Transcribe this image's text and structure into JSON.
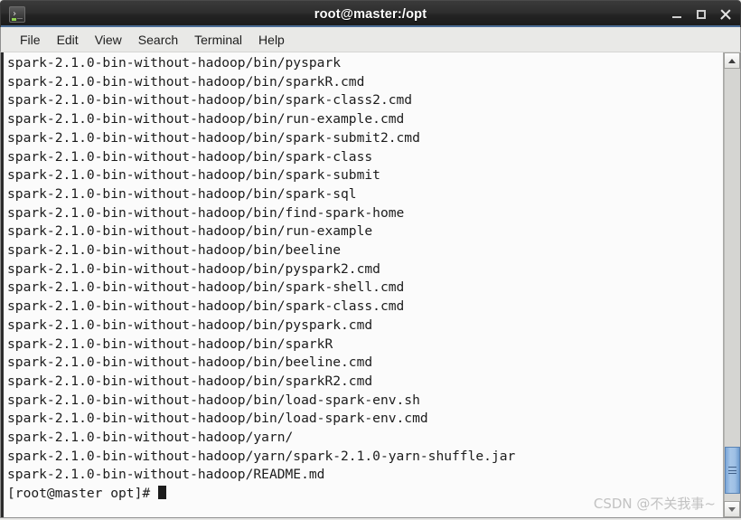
{
  "window": {
    "title": "root@master:/opt",
    "icon": "terminal-icon",
    "controls": {
      "minimize": "minimize-button",
      "maximize": "maximize-button",
      "close": "close-button"
    }
  },
  "menubar": {
    "items": [
      {
        "label": "File"
      },
      {
        "label": "Edit"
      },
      {
        "label": "View"
      },
      {
        "label": "Search"
      },
      {
        "label": "Terminal"
      },
      {
        "label": "Help"
      }
    ]
  },
  "terminal": {
    "lines": [
      "spark-2.1.0-bin-without-hadoop/bin/pyspark",
      "spark-2.1.0-bin-without-hadoop/bin/sparkR.cmd",
      "spark-2.1.0-bin-without-hadoop/bin/spark-class2.cmd",
      "spark-2.1.0-bin-without-hadoop/bin/run-example.cmd",
      "spark-2.1.0-bin-without-hadoop/bin/spark-submit2.cmd",
      "spark-2.1.0-bin-without-hadoop/bin/spark-class",
      "spark-2.1.0-bin-without-hadoop/bin/spark-submit",
      "spark-2.1.0-bin-without-hadoop/bin/spark-sql",
      "spark-2.1.0-bin-without-hadoop/bin/find-spark-home",
      "spark-2.1.0-bin-without-hadoop/bin/run-example",
      "spark-2.1.0-bin-without-hadoop/bin/beeline",
      "spark-2.1.0-bin-without-hadoop/bin/pyspark2.cmd",
      "spark-2.1.0-bin-without-hadoop/bin/spark-shell.cmd",
      "spark-2.1.0-bin-without-hadoop/bin/spark-class.cmd",
      "spark-2.1.0-bin-without-hadoop/bin/pyspark.cmd",
      "spark-2.1.0-bin-without-hadoop/bin/sparkR",
      "spark-2.1.0-bin-without-hadoop/bin/beeline.cmd",
      "spark-2.1.0-bin-without-hadoop/bin/sparkR2.cmd",
      "spark-2.1.0-bin-without-hadoop/bin/load-spark-env.sh",
      "spark-2.1.0-bin-without-hadoop/bin/load-spark-env.cmd",
      "spark-2.1.0-bin-without-hadoop/yarn/",
      "spark-2.1.0-bin-without-hadoop/yarn/spark-2.1.0-yarn-shuffle.jar",
      "spark-2.1.0-bin-without-hadoop/README.md"
    ],
    "prompt": "[root@master opt]# ",
    "watermark": "CSDN @不关我事~"
  },
  "scrollbar": {
    "up_arrow": "scroll-up-arrow",
    "down_arrow": "scroll-down-arrow",
    "thumb": "scroll-thumb"
  },
  "colors": {
    "titlebar_bg": "#2a2a2a",
    "titlebar_accent": "#4a6c96",
    "menubar_bg": "#e9e9e7",
    "terminal_bg": "#fbfbfb",
    "terminal_fg": "#1c1c1c",
    "scrollbar_thumb": "#9dbfe4",
    "watermark_fg": "#c2c2c2"
  }
}
